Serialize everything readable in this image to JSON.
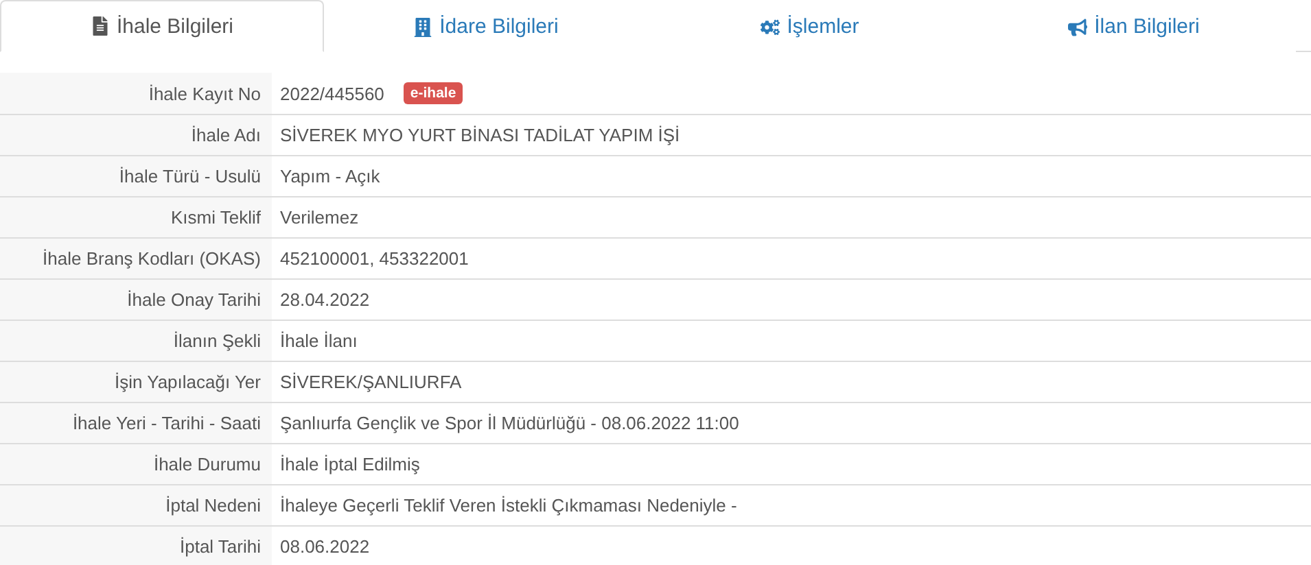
{
  "tabs": [
    {
      "label": "İhale Bilgileri",
      "kind": "file",
      "selected": true
    },
    {
      "label": "İdare Bilgileri",
      "kind": "building",
      "selected": false
    },
    {
      "label": "İşlemler",
      "kind": "gears",
      "selected": false
    },
    {
      "label": "İlan Bilgileri",
      "kind": "bullhorn",
      "selected": false
    }
  ],
  "rows": [
    {
      "label": "İhale Kayıt No",
      "value": "2022/445560",
      "badge": "e-ihale"
    },
    {
      "label": "İhale Adı",
      "value": "SİVEREK MYO YURT BİNASI TADİLAT YAPIM İŞİ"
    },
    {
      "label": "İhale Türü - Usulü",
      "value": "Yapım - Açık"
    },
    {
      "label": "Kısmi Teklif",
      "value": "Verilemez"
    },
    {
      "label": "İhale Branş Kodları (OKAS)",
      "value": "452100001, 453322001"
    },
    {
      "label": "İhale Onay Tarihi",
      "value": "28.04.2022"
    },
    {
      "label": "İlanın Şekli",
      "value": "İhale İlanı"
    },
    {
      "label": "İşin Yapılacağı Yer",
      "value": "SİVEREK/ŞANLIURFA"
    },
    {
      "label": "İhale Yeri - Tarihi - Saati",
      "value": "Şanlıurfa Gençlik ve Spor İl Müdürlüğü - 08.06.2022 11:00"
    },
    {
      "label": "İhale Durumu",
      "value": "İhale İptal Edilmiş"
    },
    {
      "label": "İptal Nedeni",
      "value": "İhaleye Geçerli Teklif Veren İstekli Çıkmaması Nedeniyle -"
    },
    {
      "label": "İptal Tarihi",
      "value": "08.06.2022"
    }
  ]
}
